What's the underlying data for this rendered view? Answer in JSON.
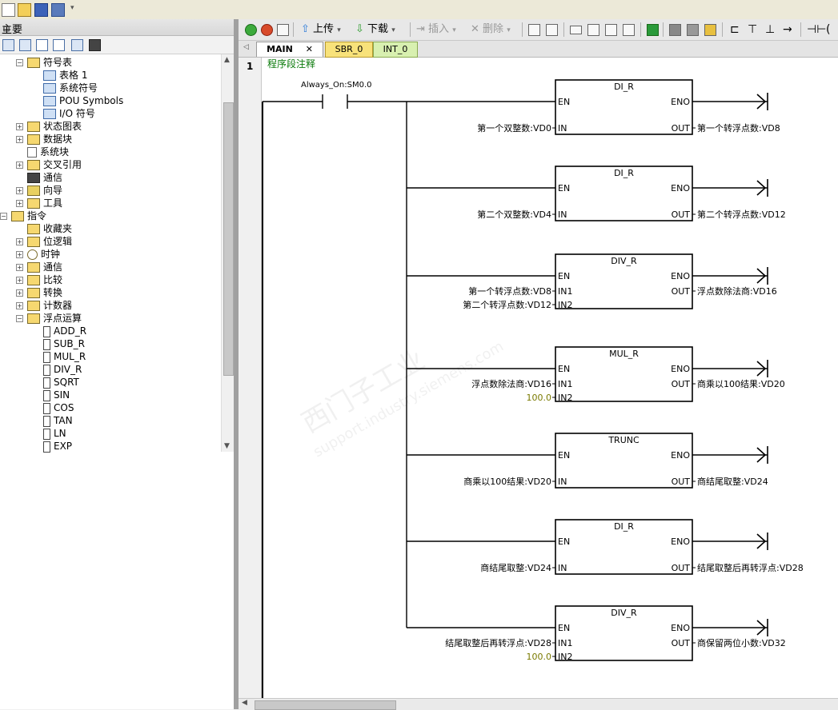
{
  "left_panel": {
    "title": "主要",
    "pin": "ㅁ",
    "tree": [
      {
        "label": "符号表",
        "level": 1,
        "icon": "folder",
        "expander": "-"
      },
      {
        "label": "表格 1",
        "level": 2,
        "icon": "table"
      },
      {
        "label": "系统符号",
        "level": 2,
        "icon": "table"
      },
      {
        "label": "POU Symbols",
        "level": 2,
        "icon": "table"
      },
      {
        "label": "I/O 符号",
        "level": 2,
        "icon": "table"
      },
      {
        "label": "状态图表",
        "level": 1,
        "icon": "folder",
        "expander": "+"
      },
      {
        "label": "数据块",
        "level": 1,
        "icon": "folder",
        "expander": "+"
      },
      {
        "label": "系统块",
        "level": 1,
        "icon": "doc"
      },
      {
        "label": "交叉引用",
        "level": 1,
        "icon": "folder",
        "expander": "+"
      },
      {
        "label": "通信",
        "level": 1,
        "icon": "monitor"
      },
      {
        "label": "向导",
        "level": 1,
        "icon": "wand",
        "expander": "+"
      },
      {
        "label": "工具",
        "level": 1,
        "icon": "folder",
        "expander": "+"
      },
      {
        "label": "指令",
        "level": 0,
        "icon": "folder",
        "expander": "-"
      },
      {
        "label": "收藏夹",
        "level": 1,
        "icon": "folder"
      },
      {
        "label": "位逻辑",
        "level": 1,
        "icon": "folder",
        "expander": "+"
      },
      {
        "label": "时钟",
        "level": 1,
        "icon": "clock",
        "expander": "+"
      },
      {
        "label": "通信",
        "level": 1,
        "icon": "folder",
        "expander": "+"
      },
      {
        "label": "比较",
        "level": 1,
        "icon": "folder",
        "expander": "+"
      },
      {
        "label": "转换",
        "level": 1,
        "icon": "folder",
        "expander": "+"
      },
      {
        "label": "计数器",
        "level": 1,
        "icon": "folder",
        "expander": "+"
      },
      {
        "label": "浮点运算",
        "level": 1,
        "icon": "folder",
        "expander": "-"
      },
      {
        "label": "ADD_R",
        "level": 2,
        "icon": "block"
      },
      {
        "label": "SUB_R",
        "level": 2,
        "icon": "block"
      },
      {
        "label": "MUL_R",
        "level": 2,
        "icon": "block"
      },
      {
        "label": "DIV_R",
        "level": 2,
        "icon": "block"
      },
      {
        "label": "SQRT",
        "level": 2,
        "icon": "block"
      },
      {
        "label": "SIN",
        "level": 2,
        "icon": "block"
      },
      {
        "label": "COS",
        "level": 2,
        "icon": "block"
      },
      {
        "label": "TAN",
        "level": 2,
        "icon": "block"
      },
      {
        "label": "LN",
        "level": 2,
        "icon": "block"
      },
      {
        "label": "EXP",
        "level": 2,
        "icon": "block"
      }
    ]
  },
  "toolbar": {
    "upload": "上传",
    "download": "下载",
    "insert": "插入",
    "delete": "删除"
  },
  "tabs": [
    "MAIN",
    "SBR_0",
    "INT_0"
  ],
  "network": {
    "number": "1",
    "comment": "程序段注释",
    "contact": "Always_On:SM0.0",
    "blocks": [
      {
        "name": "DI_R",
        "en": "EN",
        "eno": "ENO",
        "inputs": [
          {
            "pin": "IN",
            "operand": "第一个双整数:VD0"
          }
        ],
        "out_pin": "OUT",
        "out": "第一个转浮点数:VD8"
      },
      {
        "name": "DI_R",
        "en": "EN",
        "eno": "ENO",
        "inputs": [
          {
            "pin": "IN",
            "operand": "第二个双整数:VD4"
          }
        ],
        "out_pin": "OUT",
        "out": "第二个转浮点数:VD12"
      },
      {
        "name": "DIV_R",
        "en": "EN",
        "eno": "ENO",
        "inputs": [
          {
            "pin": "IN1",
            "operand": "第一个转浮点数:VD8"
          },
          {
            "pin": "IN2",
            "operand": "第二个转浮点数:VD12"
          }
        ],
        "out_pin": "OUT",
        "out": "浮点数除法商:VD16"
      },
      {
        "name": "MUL_R",
        "en": "EN",
        "eno": "ENO",
        "inputs": [
          {
            "pin": "IN1",
            "operand": "浮点数除法商:VD16"
          },
          {
            "pin": "IN2",
            "operand": "100.0",
            "constant": true
          }
        ],
        "out_pin": "OUT",
        "out": "商乘以100结果:VD20"
      },
      {
        "name": "TRUNC",
        "en": "EN",
        "eno": "ENO",
        "inputs": [
          {
            "pin": "IN",
            "operand": "商乘以100结果:VD20"
          }
        ],
        "out_pin": "OUT",
        "out": "商结尾取整:VD24"
      },
      {
        "name": "DI_R",
        "en": "EN",
        "eno": "ENO",
        "inputs": [
          {
            "pin": "IN",
            "operand": "商结尾取整:VD24"
          }
        ],
        "out_pin": "OUT",
        "out": "结尾取整后再转浮点:VD28"
      },
      {
        "name": "DIV_R",
        "en": "EN",
        "eno": "ENO",
        "inputs": [
          {
            "pin": "IN1",
            "operand": "结尾取整后再转浮点:VD28"
          },
          {
            "pin": "IN2",
            "operand": "100.0",
            "constant": true
          }
        ],
        "out_pin": "OUT",
        "out": "商保留两位小数:VD32"
      }
    ]
  },
  "watermark": {
    "cn": "西门子工业",
    "url": "support.industry.siemens.com"
  },
  "colors": {
    "comment": "#0a7a0a",
    "constant": "#7a7a00",
    "tab_sbr": "#f8e27a",
    "tab_int": "#d8f0b0"
  }
}
